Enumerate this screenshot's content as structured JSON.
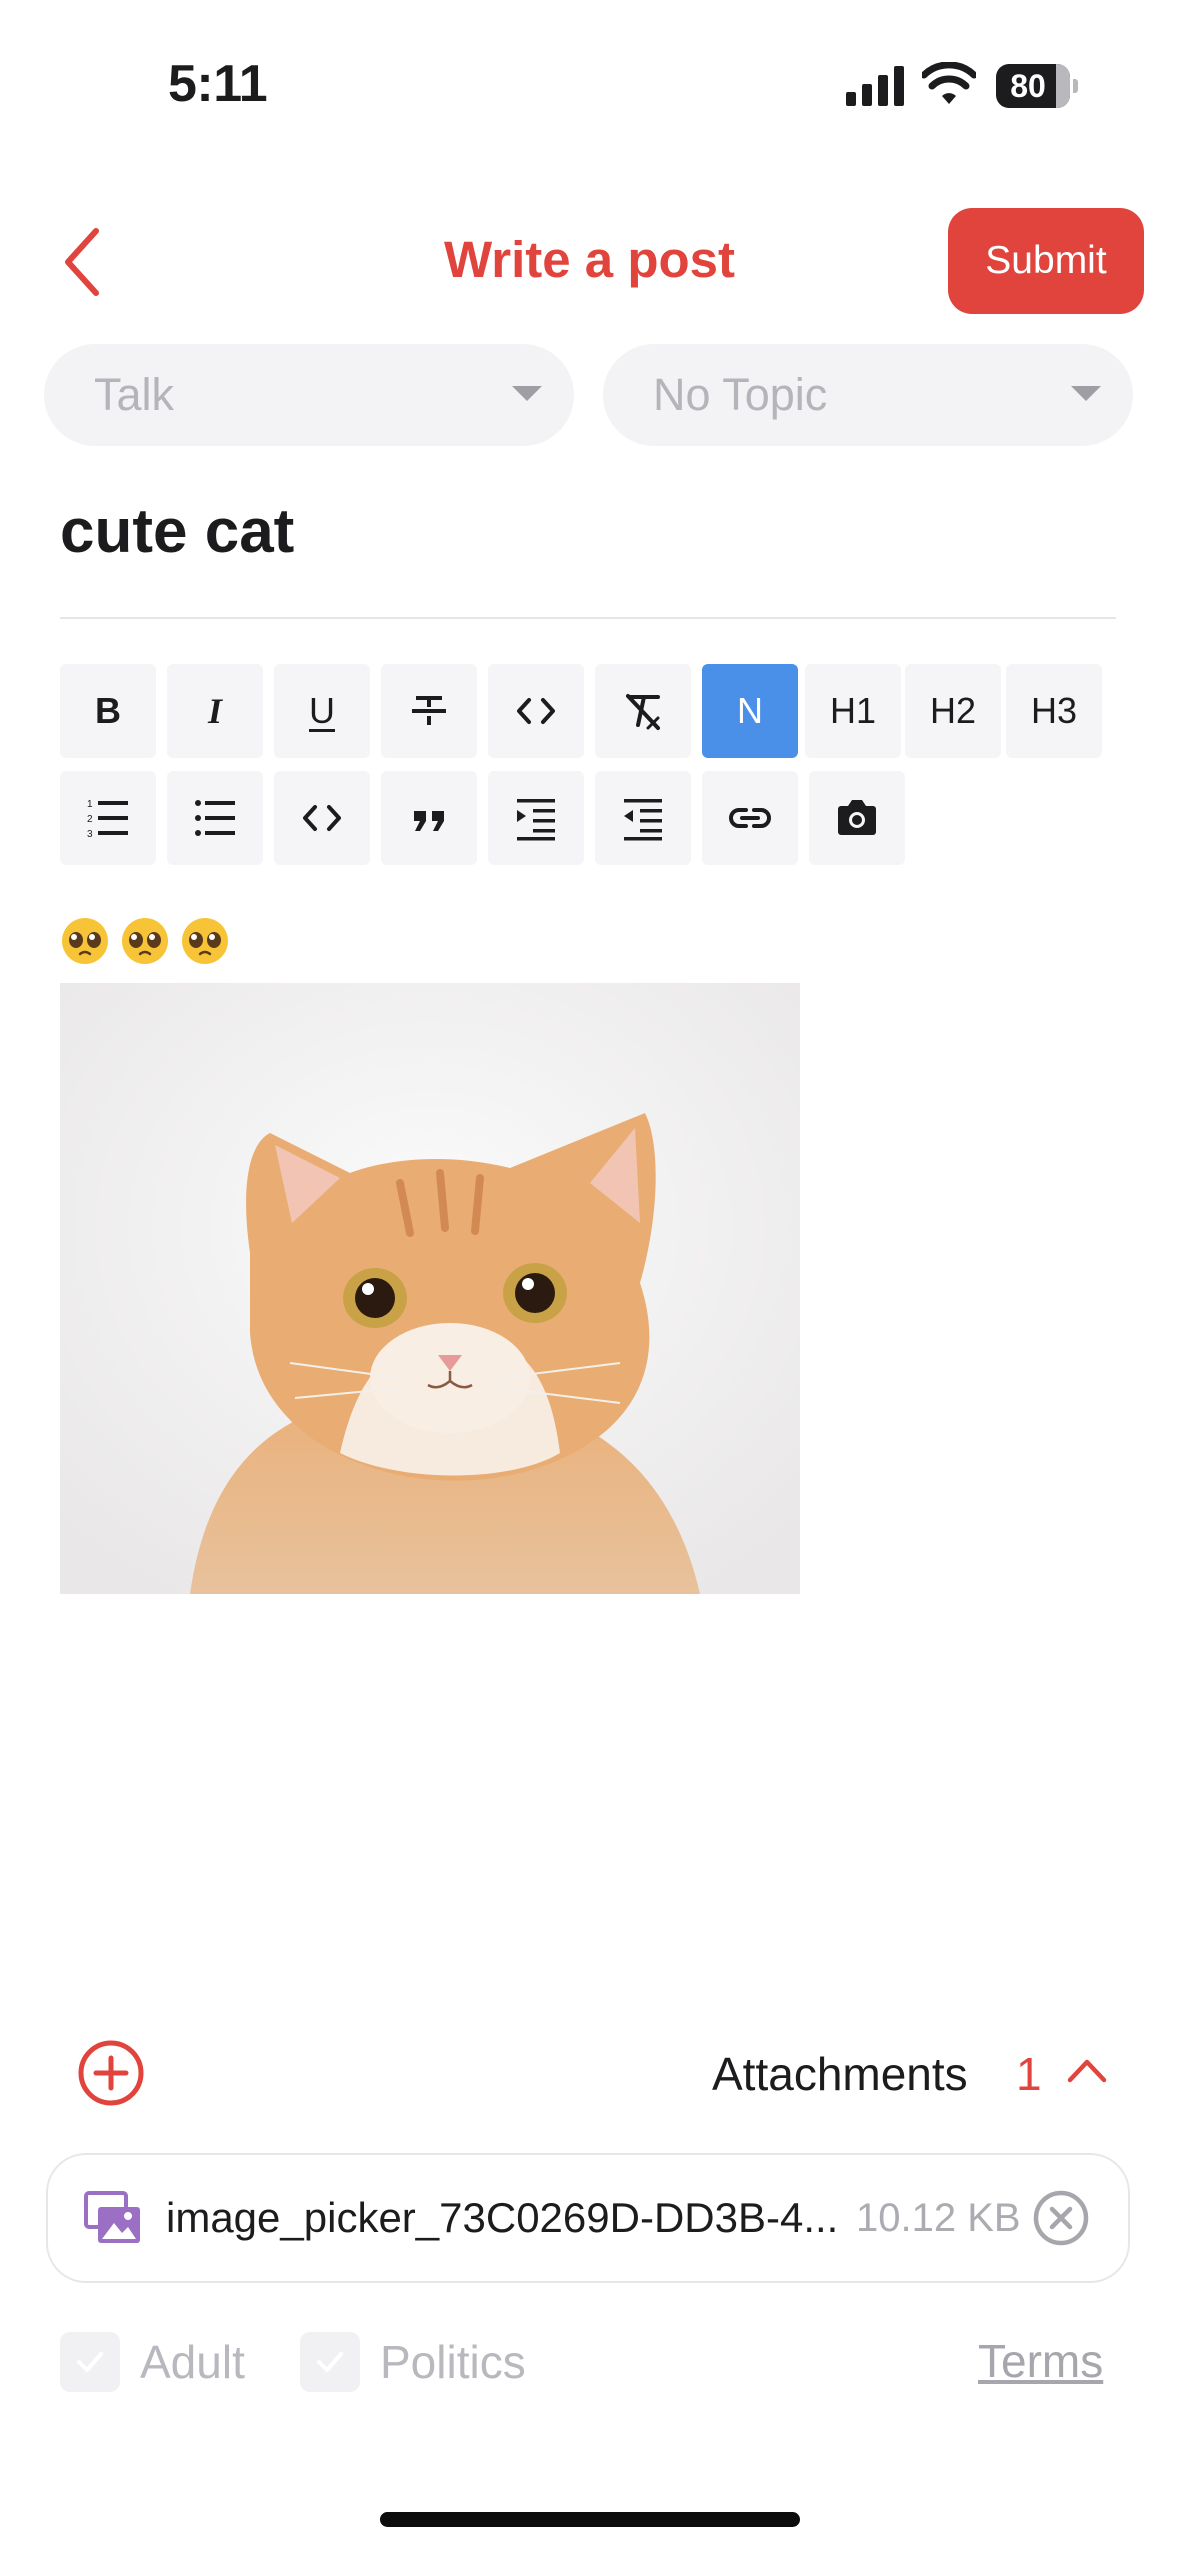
{
  "status_bar": {
    "time": "5:11",
    "battery": "80"
  },
  "header": {
    "title": "Write a post",
    "submit_label": "Submit"
  },
  "selectors": {
    "board": "Talk",
    "topic": "No Topic"
  },
  "post": {
    "title": "cute cat",
    "emoji_icon": "pleading-face"
  },
  "toolbar": {
    "row1": [
      {
        "name": "bold",
        "label": "B"
      },
      {
        "name": "italic",
        "label": "I"
      },
      {
        "name": "underline",
        "label": "U"
      },
      {
        "name": "strikethrough",
        "label": ""
      },
      {
        "name": "inline-code",
        "label": ""
      },
      {
        "name": "clear-format",
        "label": ""
      },
      {
        "name": "normal",
        "label": "N"
      },
      {
        "name": "heading-1",
        "label": "H1"
      },
      {
        "name": "heading-2",
        "label": "H2"
      },
      {
        "name": "heading-3",
        "label": "H3"
      }
    ],
    "row2": [
      {
        "name": "ordered-list",
        "label": ""
      },
      {
        "name": "bullet-list",
        "label": ""
      },
      {
        "name": "code-block",
        "label": ""
      },
      {
        "name": "quote",
        "label": ""
      },
      {
        "name": "indent",
        "label": ""
      },
      {
        "name": "outdent",
        "label": ""
      },
      {
        "name": "link",
        "label": ""
      },
      {
        "name": "camera",
        "label": ""
      }
    ],
    "active": "normal"
  },
  "attachments": {
    "label": "Attachments",
    "count": "1",
    "file_name": "image_picker_73C0269D-DD3B-4...",
    "file_size": "10.12 KB"
  },
  "flags": {
    "adult": "Adult",
    "politics": "Politics",
    "terms": "Terms"
  },
  "colors": {
    "accent": "#e0443c",
    "active_tool": "#4a90e8",
    "file_icon": "#9b6fc4"
  }
}
